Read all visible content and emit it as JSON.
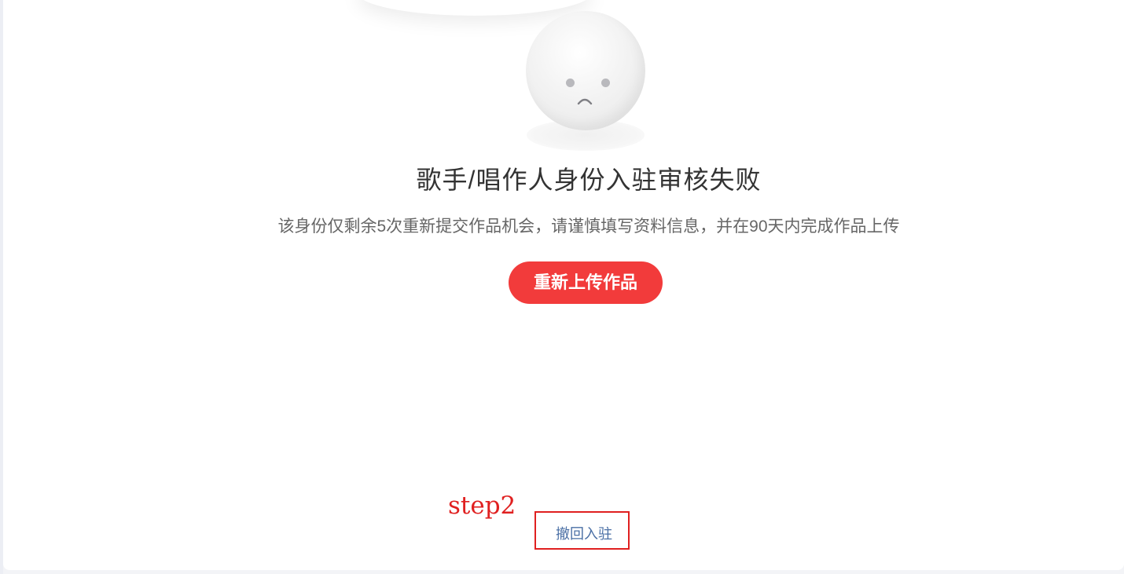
{
  "status": {
    "title": "歌手/唱作人身份入驻审核失败",
    "message": "该身份仅剩余5次重新提交作品机会，请谨慎填写资料信息，并在90天内完成作品上传"
  },
  "actions": {
    "reupload_label": "重新上传作品",
    "withdraw_label": "撤回入驻"
  },
  "annotation": {
    "step_label": "step2"
  },
  "icons": {
    "status_illustration": "sad-face-icon"
  },
  "colors": {
    "primary": "#f23b3b",
    "link": "#4a6fa5",
    "annotation": "#e02020"
  }
}
